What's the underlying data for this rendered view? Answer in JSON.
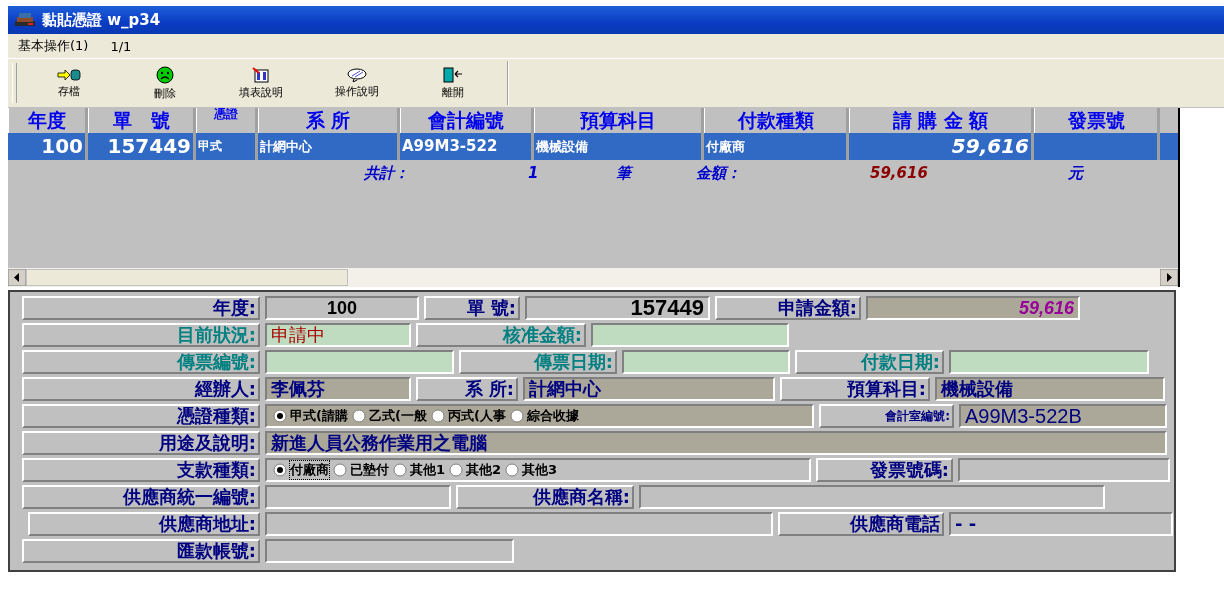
{
  "window": {
    "title": "黏貼憑證 w_p34"
  },
  "menu": {
    "items": [
      "基本操作(1)"
    ],
    "page": "1/1"
  },
  "toolbar": [
    {
      "kind": "save",
      "label": "存檔"
    },
    {
      "kind": "delete",
      "label": "刪除"
    },
    {
      "kind": "form-help",
      "label": "填表說明"
    },
    {
      "kind": "help",
      "label": "操作說明"
    },
    {
      "kind": "exit",
      "label": "離開"
    }
  ],
  "table": {
    "columns": [
      "年度",
      "單　號",
      "憑證",
      "系 所",
      "會計編號",
      "預算科目",
      "付款種類",
      "請 購 金 額",
      "發票號"
    ],
    "rows": [
      {
        "selected": true,
        "cells": [
          "100",
          "157449",
          "甲式",
          "計網中心",
          "A99M3-522",
          "機械設備",
          "付廠商",
          "59,616"
        ]
      }
    ],
    "summary": {
      "count_label": "共計：",
      "count": "1",
      "count_unit": "筆",
      "amount_label": "金額：",
      "amount": "59,616",
      "amount_unit": "元"
    }
  },
  "form": {
    "rows": [
      {
        "items": [
          {
            "kind": "label",
            "text": "年度:",
            "accent": false
          },
          {
            "kind": "field",
            "editable": false,
            "readonly": false,
            "value": "100"
          },
          {
            "kind": "label",
            "text": "單  號:",
            "accent": false
          },
          {
            "kind": "field",
            "editable": false,
            "readonly": false,
            "value": "157449"
          },
          {
            "kind": "label",
            "text": "申請金額:",
            "accent": false
          },
          {
            "kind": "field",
            "editable": false,
            "readonly": true,
            "value": "59,616"
          }
        ]
      },
      {
        "items": [
          {
            "kind": "label",
            "text": "目前狀況:",
            "accent": true
          },
          {
            "kind": "field",
            "editable": true,
            "value": "申請中"
          },
          {
            "kind": "label",
            "text": "核准金額:",
            "accent": true
          },
          {
            "kind": "field",
            "editable": true
          }
        ]
      },
      {
        "items": [
          {
            "kind": "label",
            "text": "傳票編號:",
            "accent": true
          },
          {
            "kind": "field",
            "editable": true
          },
          {
            "kind": "label",
            "text": "傳票日期:",
            "accent": true
          },
          {
            "kind": "field",
            "editable": true
          },
          {
            "kind": "label",
            "text": "付款日期:",
            "accent": true
          },
          {
            "kind": "field",
            "editable": true
          }
        ]
      },
      {
        "items": [
          {
            "kind": "label",
            "text": "經辦人:",
            "accent": false
          },
          {
            "kind": "field",
            "editable": false,
            "readonly": true,
            "value": "李佩芬"
          },
          {
            "kind": "label",
            "text": "系  所:",
            "accent": false
          },
          {
            "kind": "field",
            "editable": false,
            "readonly": true,
            "value": "計網中心"
          },
          {
            "kind": "label",
            "text": "預算科目:",
            "accent": false
          },
          {
            "kind": "field",
            "editable": false,
            "readonly": true,
            "value": "機械設備"
          }
        ]
      },
      {
        "items": [
          {
            "kind": "label",
            "text": "憑證種類:",
            "accent": false
          },
          {
            "kind": "radios",
            "readonly": true,
            "options": [
              {
                "label": "甲式(請購",
                "selected": true
              },
              {
                "label": "乙式(一般",
                "selected": false
              },
              {
                "label": "丙式(人事",
                "selected": false
              },
              {
                "label": "綜合收據",
                "selected": false
              }
            ]
          },
          {
            "kind": "label",
            "text": "會計室編號:",
            "accent": false
          },
          {
            "kind": "field",
            "editable": false,
            "readonly": true,
            "value": "A99M3-522B"
          }
        ]
      },
      {
        "items": [
          {
            "kind": "label",
            "text": "用途及說明:",
            "accent": false
          },
          {
            "kind": "field",
            "editable": false,
            "readonly": true,
            "value": "新進人員公務作業用之電腦"
          }
        ]
      },
      {
        "items": [
          {
            "kind": "label",
            "text": "支款種類:",
            "accent": false
          },
          {
            "kind": "radios",
            "readonly": false,
            "options": [
              {
                "label": "付廠商",
                "selected": true
              },
              {
                "label": "已墊付",
                "selected": false
              },
              {
                "label": "其他1",
                "selected": false
              },
              {
                "label": "其他2",
                "selected": false
              },
              {
                "label": "其他3",
                "selected": false
              }
            ]
          },
          {
            "kind": "label",
            "text": "發票號碼:",
            "accent": false
          },
          {
            "kind": "field",
            "editable": false,
            "readonly": false
          }
        ]
      },
      {
        "items": [
          {
            "kind": "label",
            "text": "供應商統一編號:",
            "accent": false
          },
          {
            "kind": "field",
            "editable": false,
            "readonly": false
          },
          {
            "kind": "label",
            "text": "供應商名稱:",
            "accent": false
          },
          {
            "kind": "field",
            "editable": false,
            "readonly": false
          }
        ]
      },
      {
        "items": [
          {
            "kind": "label",
            "text": "供應商地址:",
            "accent": false
          },
          {
            "kind": "field",
            "editable": false,
            "readonly": false
          },
          {
            "kind": "label",
            "text": "供應商電話",
            "accent": false
          },
          {
            "kind": "field",
            "editable": false,
            "readonly": false,
            "value": "-   -"
          }
        ]
      },
      {
        "items": [
          {
            "kind": "label",
            "text": "匯款帳號:",
            "accent": false
          },
          {
            "kind": "field",
            "editable": false,
            "readonly": false
          }
        ]
      }
    ]
  }
}
